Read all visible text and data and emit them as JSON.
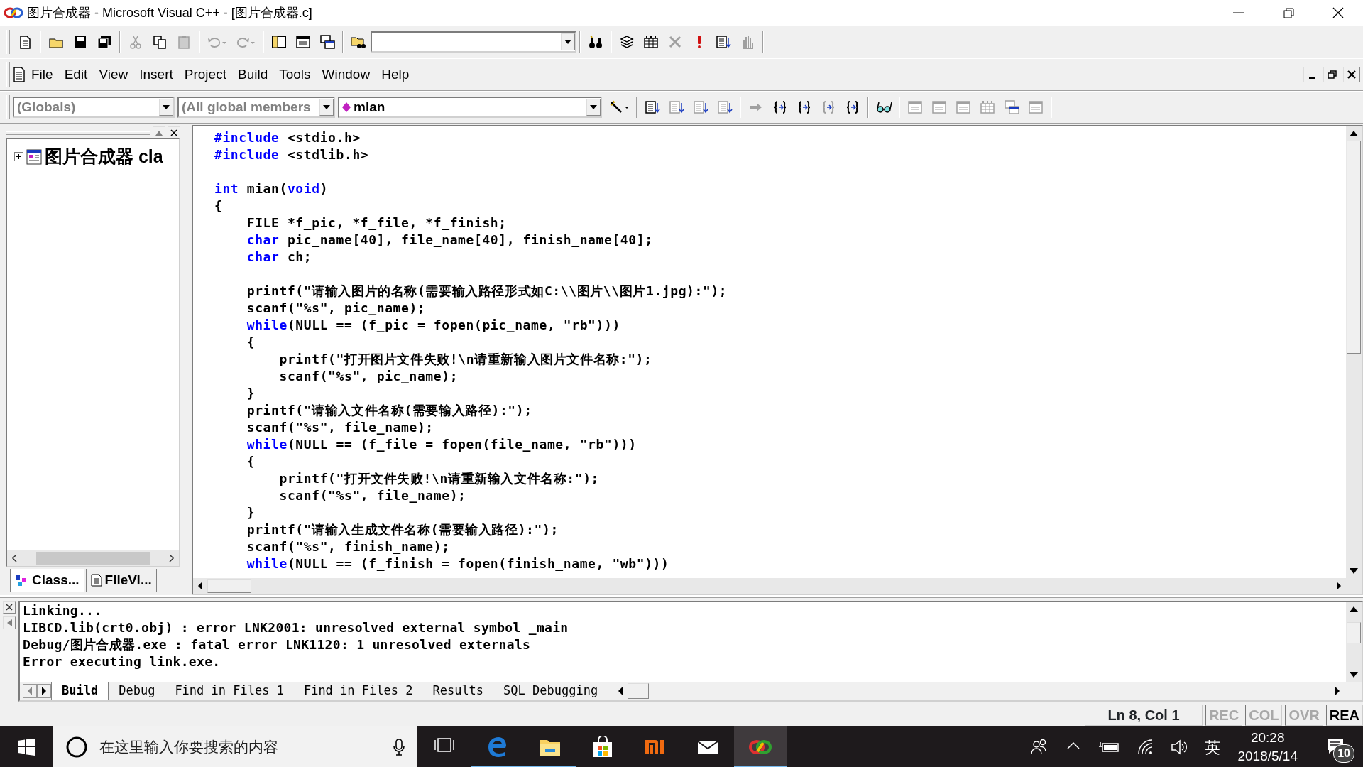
{
  "window": {
    "title": "图片合成器 - Microsoft Visual C++ - [图片合成器.c]"
  },
  "toolbar": [
    {
      "kind": "new-doc",
      "disabled": false
    },
    {
      "kind": "separator"
    },
    {
      "kind": "folder",
      "disabled": false
    },
    {
      "kind": "disk",
      "disabled": false
    },
    {
      "kind": "disks",
      "disabled": false
    },
    {
      "kind": "separator"
    },
    {
      "kind": "scissors",
      "disabled": true
    },
    {
      "kind": "copy",
      "disabled": false
    },
    {
      "kind": "clipboard",
      "disabled": true
    },
    {
      "kind": "separator"
    },
    {
      "kind": "undo",
      "disabled": true
    },
    {
      "kind": "redo",
      "disabled": true
    },
    {
      "kind": "separator"
    },
    {
      "kind": "panel",
      "disabled": false
    },
    {
      "kind": "window",
      "disabled": false
    },
    {
      "kind": "windows",
      "disabled": false
    },
    {
      "kind": "separator"
    },
    {
      "kind": "folder-search",
      "disabled": false
    },
    {
      "kind": "combo"
    },
    {
      "kind": "separator"
    },
    {
      "kind": "binoculars",
      "disabled": false
    },
    {
      "kind": "separator"
    },
    {
      "kind": "stack",
      "disabled": false
    },
    {
      "kind": "grid",
      "disabled": false
    },
    {
      "kind": "cross",
      "disabled": true
    },
    {
      "kind": "exclaim",
      "disabled": false
    },
    {
      "kind": "list",
      "disabled": false
    },
    {
      "kind": "hand",
      "disabled": true
    }
  ],
  "menu": [
    "File",
    "Edit",
    "View",
    "Insert",
    "Project",
    "Build",
    "Tools",
    "Window",
    "Help"
  ],
  "wizard_bar": {
    "scope": "(Globals)",
    "filter": "(All global members",
    "function": "mian"
  },
  "wizard_tools": [
    {
      "kind": "wand",
      "disabled": false
    },
    {
      "kind": "separator"
    },
    {
      "kind": "list",
      "disabled": false
    },
    {
      "kind": "list",
      "disabled": true
    },
    {
      "kind": "list",
      "disabled": true
    },
    {
      "kind": "list",
      "disabled": true
    },
    {
      "kind": "separator"
    },
    {
      "kind": "arrow",
      "disabled": true
    },
    {
      "kind": "braces",
      "disabled": false
    },
    {
      "kind": "braces",
      "disabled": false
    },
    {
      "kind": "braces",
      "disabled": true
    },
    {
      "kind": "braces",
      "disabled": false
    },
    {
      "kind": "separator"
    },
    {
      "kind": "glasses",
      "disabled": false
    },
    {
      "kind": "separator"
    },
    {
      "kind": "window",
      "disabled": true
    },
    {
      "kind": "window",
      "disabled": true
    },
    {
      "kind": "window",
      "disabled": true
    },
    {
      "kind": "grid",
      "disabled": true
    },
    {
      "kind": "windows",
      "disabled": true
    },
    {
      "kind": "window",
      "disabled": true
    }
  ],
  "workspace": {
    "tree": [
      {
        "label": "图片合成器 cla",
        "expanded": false
      }
    ],
    "tabs": [
      {
        "label": "Class...",
        "selected": true
      },
      {
        "label": "FileVi...",
        "selected": false
      }
    ]
  },
  "editor": {
    "lines": [
      {
        "kind": "code",
        "segments": [
          {
            "t": "#include",
            "kind": "keyword"
          },
          {
            "t": " <stdio.h>",
            "kind": "plain"
          }
        ]
      },
      {
        "kind": "code",
        "segments": [
          {
            "t": "#include",
            "kind": "keyword"
          },
          {
            "t": " <stdlib.h>",
            "kind": "plain"
          }
        ]
      },
      {
        "kind": "blank"
      },
      {
        "kind": "code",
        "segments": [
          {
            "t": "int",
            "kind": "keyword"
          },
          {
            "t": " mian(",
            "kind": "plain"
          },
          {
            "t": "void",
            "kind": "keyword"
          },
          {
            "t": ")",
            "kind": "plain"
          }
        ]
      },
      {
        "kind": "code",
        "segments": [
          {
            "t": "{",
            "kind": "plain"
          }
        ]
      },
      {
        "kind": "code",
        "segments": [
          {
            "t": "    FILE *f_pic, *f_file, *f_finish;",
            "kind": "plain"
          }
        ]
      },
      {
        "kind": "code",
        "segments": [
          {
            "t": "    char",
            "kind": "keyword"
          },
          {
            "t": " pic_name[40], file_name[40], finish_name[40];",
            "kind": "plain"
          }
        ]
      },
      {
        "kind": "code",
        "segments": [
          {
            "t": "    char",
            "kind": "keyword"
          },
          {
            "t": " ch;",
            "kind": "plain"
          }
        ]
      },
      {
        "kind": "blank"
      },
      {
        "kind": "code",
        "segments": [
          {
            "t": "    printf(\"请输入图片的名称(需要输入路径形式如C:\\\\图片\\\\图片1.jpg):\");",
            "kind": "plain"
          }
        ]
      },
      {
        "kind": "code",
        "segments": [
          {
            "t": "    scanf(\"%s\", pic_name);",
            "kind": "plain"
          }
        ]
      },
      {
        "kind": "code",
        "segments": [
          {
            "t": "    while",
            "kind": "keyword"
          },
          {
            "t": "(NULL == (f_pic = fopen(pic_name, \"rb\")))",
            "kind": "plain"
          }
        ]
      },
      {
        "kind": "code",
        "segments": [
          {
            "t": "    {",
            "kind": "plain"
          }
        ]
      },
      {
        "kind": "code",
        "segments": [
          {
            "t": "        printf(\"打开图片文件失败!\\n请重新输入图片文件名称:\");",
            "kind": "plain"
          }
        ]
      },
      {
        "kind": "code",
        "segments": [
          {
            "t": "        scanf(\"%s\", pic_name);",
            "kind": "plain"
          }
        ]
      },
      {
        "kind": "code",
        "segments": [
          {
            "t": "    }",
            "kind": "plain"
          }
        ]
      },
      {
        "kind": "code",
        "segments": [
          {
            "t": "    printf(\"请输入文件名称(需要输入路径):\");",
            "kind": "plain"
          }
        ]
      },
      {
        "kind": "code",
        "segments": [
          {
            "t": "    scanf(\"%s\", file_name);",
            "kind": "plain"
          }
        ]
      },
      {
        "kind": "code",
        "segments": [
          {
            "t": "    while",
            "kind": "keyword"
          },
          {
            "t": "(NULL == (f_file = fopen(file_name, \"rb\")))",
            "kind": "plain"
          }
        ]
      },
      {
        "kind": "code",
        "segments": [
          {
            "t": "    {",
            "kind": "plain"
          }
        ]
      },
      {
        "kind": "code",
        "segments": [
          {
            "t": "        printf(\"打开文件失败!\\n请重新输入文件名称:\");",
            "kind": "plain"
          }
        ]
      },
      {
        "kind": "code",
        "segments": [
          {
            "t": "        scanf(\"%s\", file_name);",
            "kind": "plain"
          }
        ]
      },
      {
        "kind": "code",
        "segments": [
          {
            "t": "    }",
            "kind": "plain"
          }
        ]
      },
      {
        "kind": "code",
        "segments": [
          {
            "t": "    printf(\"请输入生成文件名称(需要输入路径):\");",
            "kind": "plain"
          }
        ]
      },
      {
        "kind": "code",
        "segments": [
          {
            "t": "    scanf(\"%s\", finish_name);",
            "kind": "plain"
          }
        ]
      },
      {
        "kind": "code",
        "segments": [
          {
            "t": "    while",
            "kind": "keyword"
          },
          {
            "t": "(NULL == (f_finish = fopen(finish_name, \"wb\")))",
            "kind": "plain"
          }
        ]
      }
    ]
  },
  "output": {
    "lines": [
      "Linking...",
      "LIBCD.lib(crt0.obj) : error LNK2001: unresolved external symbol _main",
      "Debug/图片合成器.exe : fatal error LNK1120: 1 unresolved externals",
      "Error executing link.exe."
    ],
    "tabs": [
      {
        "label": "Build",
        "selected": true
      },
      {
        "label": "Debug",
        "selected": false
      },
      {
        "label": "Find in Files 1",
        "selected": false
      },
      {
        "label": "Find in Files 2",
        "selected": false
      },
      {
        "label": "Results",
        "selected": false
      },
      {
        "label": "SQL Debugging",
        "selected": false
      }
    ]
  },
  "status_bar": {
    "position": "Ln 8, Col 1",
    "indicators": [
      {
        "label": "REC",
        "on": false
      },
      {
        "label": "COL",
        "on": false
      },
      {
        "label": "OVR",
        "on": false
      },
      {
        "label": "REA",
        "on": true
      }
    ]
  },
  "taskbar": {
    "search": {
      "placeholder": "在这里输入你要搜索的内容"
    },
    "apps": [
      {
        "kind": "task-view",
        "running": false,
        "selected": false
      },
      {
        "kind": "edge",
        "running": true,
        "selected": false
      },
      {
        "kind": "explorer",
        "running": true,
        "selected": false
      },
      {
        "kind": "store",
        "running": false,
        "selected": false
      },
      {
        "kind": "mi",
        "running": false,
        "selected": false
      },
      {
        "kind": "mail",
        "running": false,
        "selected": false
      },
      {
        "kind": "vc",
        "running": true,
        "selected": true
      }
    ],
    "ime": "英",
    "time": "20:28",
    "date": "2018/5/14",
    "notifications": "10"
  }
}
